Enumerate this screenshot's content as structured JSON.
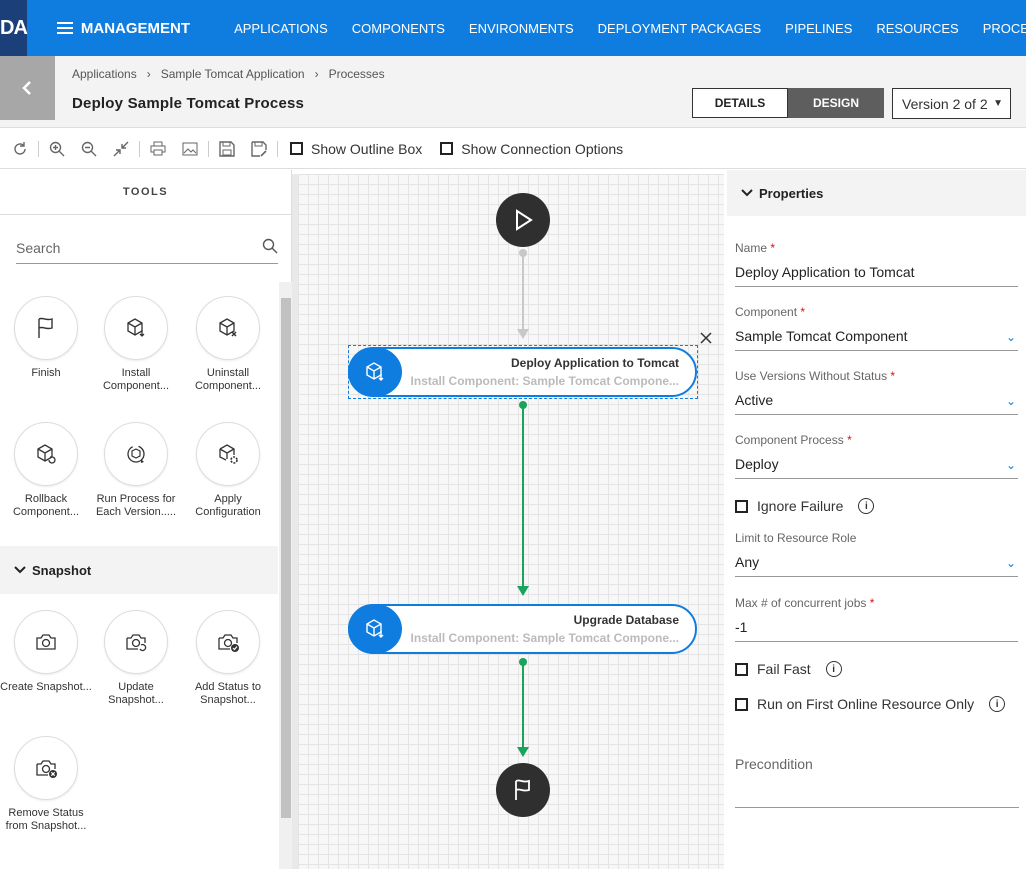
{
  "topbar": {
    "logo": "DA",
    "menu_label": "MANAGEMENT",
    "nav": [
      "APPLICATIONS",
      "COMPONENTS",
      "ENVIRONMENTS",
      "DEPLOYMENT PACKAGES",
      "PIPELINES",
      "RESOURCES",
      "PROCESSES"
    ],
    "accent": "#0f7de0"
  },
  "breadcrumb": [
    "Applications",
    "Sample Tomcat Application",
    "Processes"
  ],
  "page_title": "Deploy Sample Tomcat Process",
  "tabs": {
    "details": "DETAILS",
    "design": "DESIGN",
    "active": "DESIGN"
  },
  "version": "Version 2 of 2",
  "toolbar": {
    "icons": [
      "refresh-icon",
      "zoom-in-icon",
      "zoom-out-icon",
      "fit-icon",
      "print-icon",
      "image-icon",
      "save-icon",
      "save-as-icon"
    ],
    "show_outline": "Show Outline Box",
    "show_connection": "Show Connection Options"
  },
  "tools": {
    "header": "TOOLS",
    "search_placeholder": "Search",
    "items": [
      {
        "label": "Finish",
        "icon": "flag-icon"
      },
      {
        "label": "Install Component...",
        "icon": "install-icon"
      },
      {
        "label": "Uninstall Component...",
        "icon": "uninstall-icon"
      },
      {
        "label": "Rollback Component...",
        "icon": "rollback-icon"
      },
      {
        "label": "Run Process for Each Version.....",
        "icon": "run-each-icon"
      },
      {
        "label": "Apply Configuration",
        "icon": "configuration-icon"
      }
    ],
    "snapshot_header": "Snapshot",
    "snapshot_items": [
      {
        "label": "Create Snapshot...",
        "icon": "camera-icon"
      },
      {
        "label": "Update Snapshot...",
        "icon": "camera-update-icon"
      },
      {
        "label": "Add Status to Snapshot...",
        "icon": "camera-check-icon"
      },
      {
        "label": "Remove Status from Snapshot...",
        "icon": "camera-remove-icon"
      }
    ]
  },
  "canvas": {
    "nodes": [
      {
        "title": "Deploy Application to Tomcat",
        "subtitle": "Install Component: Sample Tomcat Compone..."
      },
      {
        "title": "Upgrade Database",
        "subtitle": "Install Component: Sample Tomcat Compone..."
      }
    ],
    "connector_color": "#1aa35b"
  },
  "properties": {
    "header": "Properties",
    "name_label": "Name",
    "name_value": "Deploy Application to Tomcat",
    "component_label": "Component",
    "component_value": "Sample Tomcat Component",
    "versions_label": "Use Versions Without Status",
    "versions_value": "Active",
    "process_label": "Component Process",
    "process_value": "Deploy",
    "ignore_failure": "Ignore Failure",
    "limit_label": "Limit to Resource Role",
    "limit_value": "Any",
    "max_label": "Max # of concurrent jobs",
    "max_value": "-1",
    "fail_fast": "Fail Fast",
    "run_first": "Run on First Online Resource Only",
    "precondition": "Precondition"
  }
}
